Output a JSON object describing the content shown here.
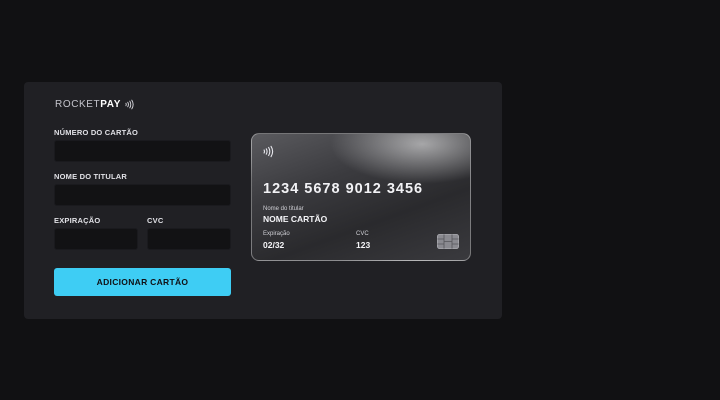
{
  "brand": {
    "name_light": "ROCKET",
    "name_bold": "PAY"
  },
  "form": {
    "card_number_label": "NÚMERO DO CARTÃO",
    "card_number_value": "",
    "holder_name_label": "NOME DO TITULAR",
    "holder_name_value": "",
    "expiration_label": "EXPIRAÇÃO",
    "expiration_value": "",
    "cvc_label": "CVC",
    "cvc_value": "",
    "submit_label": "ADICIONAR CARTÃO"
  },
  "card_preview": {
    "number": "1234 5678 9012 3456",
    "holder_caption": "Nome do titular",
    "holder_name": "NOME CARTÃO",
    "expiration_caption": "Expiração",
    "expiration": "02/32",
    "cvc_caption": "CVC",
    "cvc": "123"
  },
  "icons": {
    "contactless": "contactless-icon",
    "chip": "card-chip-icon"
  },
  "colors": {
    "accent": "#3ecdf4",
    "page_bg": "#111113",
    "panel_bg": "#202024",
    "input_bg": "#121214"
  }
}
